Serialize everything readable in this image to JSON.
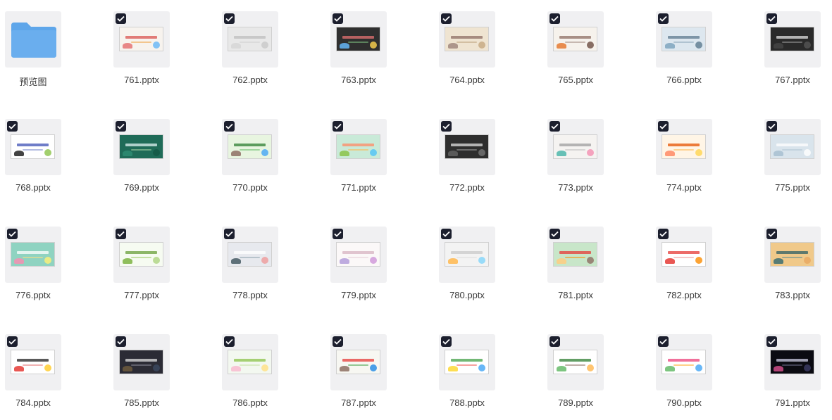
{
  "window": {
    "title": ""
  },
  "folder": {
    "label": "预览图",
    "icon": "folder-icon",
    "color": "#6aaeee"
  },
  "files": [
    {
      "name": "761.pptx",
      "theme": {
        "bg": "#f7f3ee",
        "title": "#d9534f",
        "sub": "#f0a040",
        "a1": "#e57373",
        "a2": "#64b5f6"
      }
    },
    {
      "name": "762.pptx",
      "theme": {
        "bg": "#e8e8e8",
        "title": "#bdbdbd",
        "sub": "#cfcfcf",
        "a1": "#d6d6d6",
        "a2": "#c8c8c8"
      }
    },
    {
      "name": "763.pptx",
      "theme": {
        "bg": "#2f2f2f",
        "title": "#e57373",
        "sub": "#81c784",
        "a1": "#64b5f6",
        "a2": "#ffd54f"
      }
    },
    {
      "name": "764.pptx",
      "theme": {
        "bg": "#efe4d1",
        "title": "#8d6e63",
        "sub": "#bca07c",
        "a1": "#a1887f",
        "a2": "#c5a880"
      }
    },
    {
      "name": "765.pptx",
      "theme": {
        "bg": "#f6f2ec",
        "title": "#8d6e63",
        "sub": "#a1887f",
        "a1": "#e57a33",
        "a2": "#6d4c41"
      }
    },
    {
      "name": "766.pptx",
      "theme": {
        "bg": "#dde7ef",
        "title": "#5c7a8f",
        "sub": "#8aa6b8",
        "a1": "#7fa5be",
        "a2": "#5c7a8f"
      }
    },
    {
      "name": "767.pptx",
      "theme": {
        "bg": "#2a2a2a",
        "title": "#e0e0e0",
        "sub": "#9e9e9e",
        "a1": "#444444",
        "a2": "#555555"
      }
    },
    {
      "name": "768.pptx",
      "theme": {
        "bg": "#ffffff",
        "title": "#3f51b5",
        "sub": "#7986cb",
        "a1": "#222222",
        "a2": "#8bc34a"
      }
    },
    {
      "name": "769.pptx",
      "theme": {
        "bg": "#1f6b58",
        "title": "#e0f2f1",
        "sub": "#a5d6a7",
        "a1": "#2e8b72",
        "a2": "#145846"
      }
    },
    {
      "name": "770.pptx",
      "theme": {
        "bg": "#e8f5e0",
        "title": "#2e7d32",
        "sub": "#66bb6a",
        "a1": "#8d6e63",
        "a2": "#42a5f5"
      }
    },
    {
      "name": "771.pptx",
      "theme": {
        "bg": "#c9ead8",
        "title": "#ff8a65",
        "sub": "#ffb74d",
        "a1": "#8bc34a",
        "a2": "#4fc3f7"
      }
    },
    {
      "name": "772.pptx",
      "theme": {
        "bg": "#2e2e2e",
        "title": "#e0e0e0",
        "sub": "#9e9e9e",
        "a1": "#616161",
        "a2": "#757575"
      }
    },
    {
      "name": "773.pptx",
      "theme": {
        "bg": "#f5f3f1",
        "title": "#9e9e9e",
        "sub": "#bdbdbd",
        "a1": "#4db6ac",
        "a2": "#f48fb1"
      }
    },
    {
      "name": "774.pptx",
      "theme": {
        "bg": "#fff5e6",
        "title": "#e65100",
        "sub": "#ffb74d",
        "a1": "#ff8a65",
        "a2": "#ffd54f"
      }
    },
    {
      "name": "775.pptx",
      "theme": {
        "bg": "#d9e4ec",
        "title": "#ffffff",
        "sub": "#b0c4d4",
        "a1": "#a7bfd1",
        "a2": "#ffffff"
      }
    },
    {
      "name": "776.pptx",
      "theme": {
        "bg": "#8fd3c1",
        "title": "#ffffff",
        "sub": "#ffe082",
        "a1": "#f48fb1",
        "a2": "#fff176"
      }
    },
    {
      "name": "777.pptx",
      "theme": {
        "bg": "#f6fbf1",
        "title": "#689f38",
        "sub": "#9ccc65",
        "a1": "#7cb342",
        "a2": "#aed581"
      }
    },
    {
      "name": "778.pptx",
      "theme": {
        "bg": "#e7e9ee",
        "title": "#ffffff",
        "sub": "#90a4ae",
        "a1": "#455a64",
        "a2": "#ef9a9a"
      }
    },
    {
      "name": "779.pptx",
      "theme": {
        "bg": "#fbf8f8",
        "title": "#d7b3c2",
        "sub": "#e6cdd7",
        "a1": "#b39ddb",
        "a2": "#ce93d8"
      }
    },
    {
      "name": "780.pptx",
      "theme": {
        "bg": "#f3f3f3",
        "title": "#c9c9c9",
        "sub": "#dddddd",
        "a1": "#ffb74d",
        "a2": "#81d4fa"
      }
    },
    {
      "name": "781.pptx",
      "theme": {
        "bg": "#c8e6c9",
        "title": "#e53935",
        "sub": "#fb8c00",
        "a1": "#ffcc80",
        "a2": "#8d6e63"
      }
    },
    {
      "name": "782.pptx",
      "theme": {
        "bg": "#ffffff",
        "title": "#e53935",
        "sub": "#ef9a9a",
        "a1": "#e53935",
        "a2": "#fb8c00"
      }
    },
    {
      "name": "783.pptx",
      "theme": {
        "bg": "#f0c98a",
        "title": "#2e5d63",
        "sub": "#5b8a8f",
        "a1": "#3c6e71",
        "a2": "#e8a860"
      }
    },
    {
      "name": "784.pptx",
      "theme": {
        "bg": "#ffffff",
        "title": "#222222",
        "sub": "#e57373",
        "a1": "#e53935",
        "a2": "#ffca28"
      }
    },
    {
      "name": "785.pptx",
      "theme": {
        "bg": "#2b2b35",
        "title": "#e0e0e0",
        "sub": "#8d8d99",
        "a1": "#6d5a3d",
        "a2": "#3c4a62"
      }
    },
    {
      "name": "786.pptx",
      "theme": {
        "bg": "#f3f8f0",
        "title": "#8bc34a",
        "sub": "#c5e1a5",
        "a1": "#f8bbd0",
        "a2": "#ffe082"
      }
    },
    {
      "name": "787.pptx",
      "theme": {
        "bg": "#f7f7f2",
        "title": "#e53935",
        "sub": "#43a047",
        "a1": "#8d6e63",
        "a2": "#1e88e5"
      }
    },
    {
      "name": "788.pptx",
      "theme": {
        "bg": "#ffffff",
        "title": "#43a047",
        "sub": "#ef5350",
        "a1": "#fdd835",
        "a2": "#42a5f5"
      }
    },
    {
      "name": "789.pptx",
      "theme": {
        "bg": "#ffffff",
        "title": "#2e7d32",
        "sub": "#8d6e63",
        "a1": "#66bb6a",
        "a2": "#ffb74d"
      }
    },
    {
      "name": "790.pptx",
      "theme": {
        "bg": "#ffffff",
        "title": "#ec407a",
        "sub": "#ffa726",
        "a1": "#66bb6a",
        "a2": "#42a5f5"
      }
    },
    {
      "name": "791.pptx",
      "theme": {
        "bg": "#0b0b12",
        "title": "#cfcfe6",
        "sub": "#6f6f8a",
        "a1": "#d14d8a",
        "a2": "#3c3c66"
      }
    }
  ]
}
